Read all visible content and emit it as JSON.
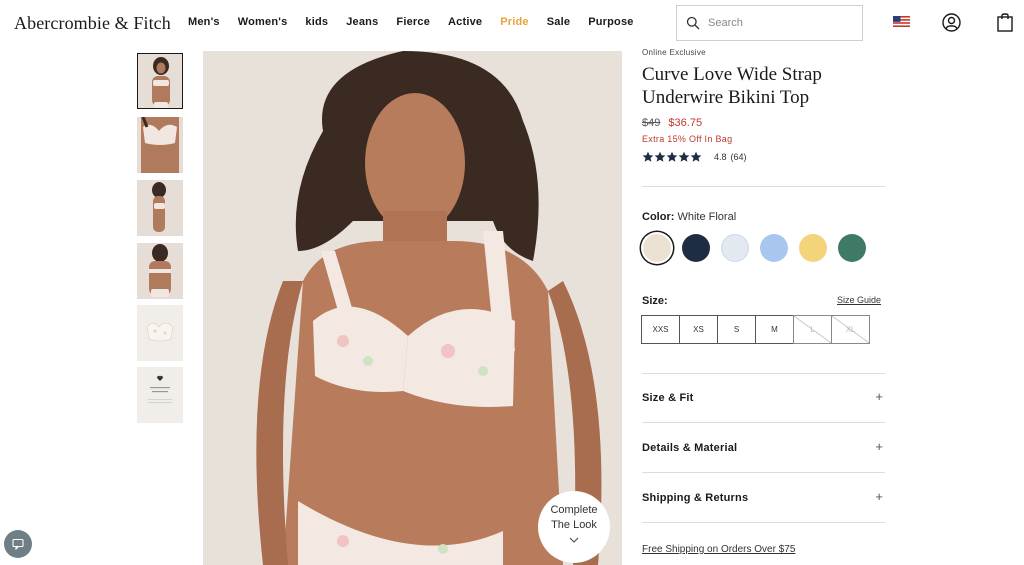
{
  "header": {
    "logo": "Abercrombie & Fitch",
    "nav": [
      "Men's",
      "Women's",
      "kids",
      "Jeans",
      "Fierce",
      "Active",
      "Pride",
      "Sale",
      "Purpose"
    ],
    "search_placeholder": "Search",
    "flag_icon": "us-flag-icon",
    "account_icon": "account-icon",
    "bag_icon": "shopping-bag-icon"
  },
  "gallery": {
    "thumbnail_count": 6,
    "selected_thumbnail": 1,
    "complete_look": {
      "line1": "Complete",
      "line2": "The Look",
      "icon": "chevron-down-icon"
    }
  },
  "product": {
    "badge": "Online Exclusive",
    "title": "Curve Love Wide Strap Underwire Bikini Top",
    "price_original": "$49",
    "price_sale": "$36.75",
    "promo": "Extra 15% Off In Bag",
    "rating": "4.8",
    "review_count": "(64)",
    "stars_filled": 5
  },
  "color": {
    "label": "Color:",
    "selected_name": "White Floral",
    "swatches": [
      {
        "name": "white-floral",
        "color": "#e9dfd2",
        "selected": true
      },
      {
        "name": "navy",
        "color": "#1f2d44",
        "selected": false
      },
      {
        "name": "blue-floral",
        "color": "#dfe7f0",
        "selected": false
      },
      {
        "name": "light-blue",
        "color": "#a9c7ee",
        "selected": false
      },
      {
        "name": "yellow",
        "color": "#f4d47b",
        "selected": false
      },
      {
        "name": "green",
        "color": "#3f7a66",
        "selected": false
      }
    ]
  },
  "size": {
    "label": "Size:",
    "guide_link": "Size Guide",
    "options": [
      {
        "label": "XXS",
        "available": true
      },
      {
        "label": "XS",
        "available": true
      },
      {
        "label": "S",
        "available": true
      },
      {
        "label": "M",
        "available": true
      },
      {
        "label": "L",
        "available": false
      },
      {
        "label": "XL",
        "available": false
      }
    ]
  },
  "accordions": [
    {
      "label": "Size & Fit",
      "icon": "plus-icon"
    },
    {
      "label": "Details & Material",
      "icon": "plus-icon"
    },
    {
      "label": "Shipping & Returns",
      "icon": "plus-icon"
    }
  ],
  "accordion_plus": "+",
  "footer_link": "Free Shipping on Orders Over $75",
  "chat_icon": "chat-icon",
  "colors": {
    "sale_red": "#c0392b",
    "pride_orange": "#e8a33a",
    "text_dark": "#1a1a1a"
  }
}
